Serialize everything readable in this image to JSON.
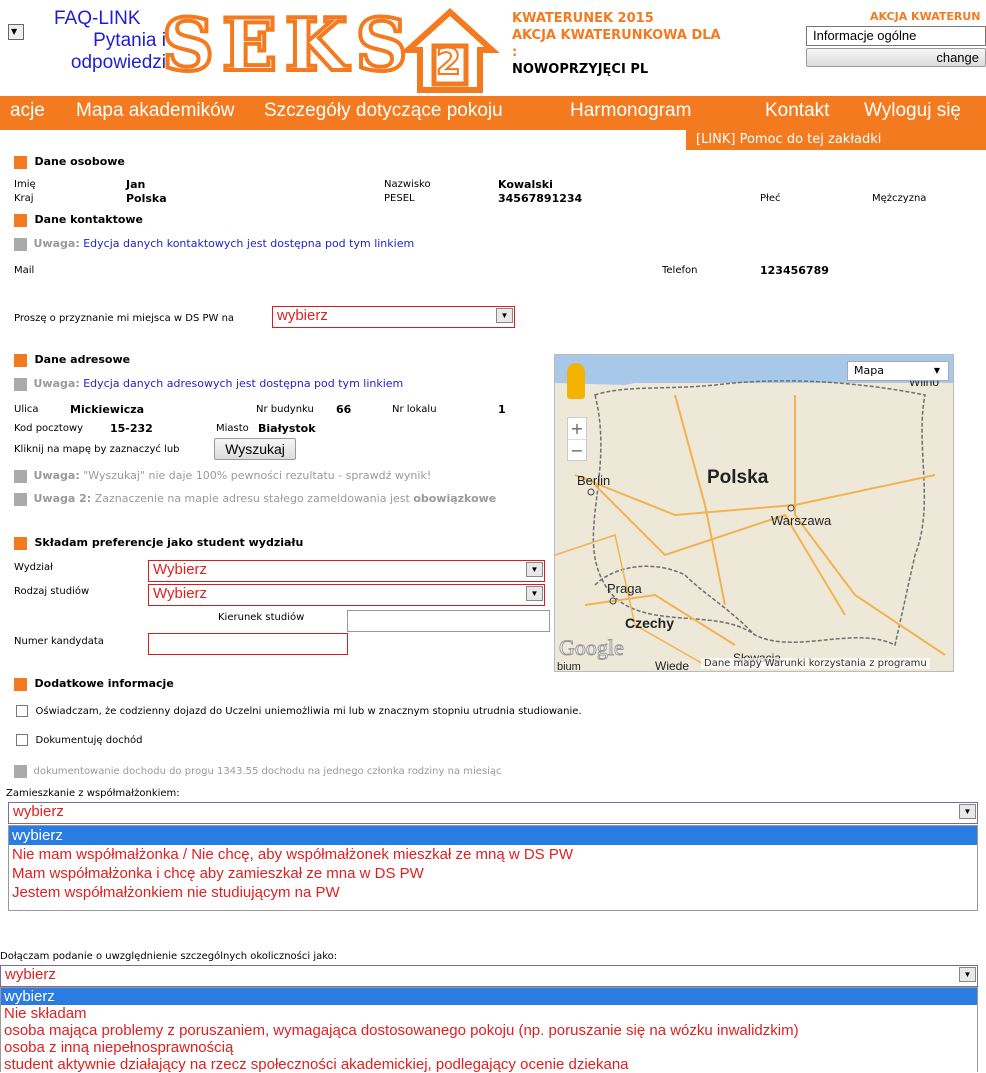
{
  "header": {
    "faq_line1": "FAQ-LINK",
    "faq_line2": "Pytania i",
    "faq_line3": "odpowiedzi",
    "logo_text": "SEKS",
    "logo_digit": "2",
    "title_line1": "KWATERUNEK 2015",
    "title_line2": "AKCJA KWATERUNKOWA DLA",
    "title_colon": ":",
    "title_line3": "NOWOPRZYJĘCI PL",
    "right_label": "AKCJA KWATERUN",
    "right_select_value": "Informacje ogólne",
    "change_button": "change"
  },
  "menu": {
    "items": [
      "acje",
      "Mapa akademików",
      "Szczegóły dotyczące pokoju",
      "Harmonogram",
      "Kontakt",
      "Wyloguj się"
    ],
    "help_link": "[LINK] Pomoc do tej zakładki"
  },
  "personal": {
    "title": "Dane osobowe",
    "first_name_label": "Imię",
    "first_name": "Jan",
    "last_name_label": "Nazwisko",
    "last_name": "Kowalski",
    "country_label": "Kraj",
    "country": "Polska",
    "pesel_label": "PESEL",
    "pesel": "34567891234",
    "sex_label": "Płeć",
    "sex": "Mężczyzna"
  },
  "contact": {
    "title": "Dane kontaktowe",
    "note_prefix": "Uwaga:",
    "note_link": "Edycja danych kontaktowych jest dostępna pod tym linkiem",
    "mail_label": "Mail",
    "phone_label": "Telefon",
    "phone": "123456789"
  },
  "request": {
    "label": "Proszę o przyznanie mi miejsca w DS PW na",
    "value": "wybierz"
  },
  "address": {
    "title": "Dane adresowe",
    "note_prefix": "Uwaga:",
    "note_link": "Edycja danych adresowych jest dostępna pod tym linkiem",
    "street_label": "Ulica",
    "street": "Mickiewicza",
    "building_label": "Nr budynku",
    "building": "66",
    "flat_label": "Nr lokalu",
    "flat": "1",
    "zip_label": "Kod pocztowy",
    "zip": "15-232",
    "city_label": "Miasto",
    "city": "Białystok",
    "map_hint": "Kliknij na mapę by zaznaczyć lub",
    "search_button": "Wyszukaj",
    "warn1_prefix": "Uwaga:",
    "warn1_text": "\"Wyszukaj\" nie daje 100% pewności rezultatu - sprawdź wynik!",
    "warn2_prefix": "Uwaga 2:",
    "warn2_text": "Zaznaczenie na mapie adresu stałego zameldowania jest",
    "warn2_bold": "obowiązkowe"
  },
  "map": {
    "type_label": "Mapa",
    "label_polska": "Polska",
    "label_berlin": "Berlin",
    "label_warszawa": "Warszawa",
    "label_praga": "Praga",
    "label_czechy": "Czechy",
    "label_wilno": "Wilno",
    "label_wieden": "Wiede",
    "label_slowacja": "Słowacja",
    "label_bium": "bium",
    "google": "Google",
    "attribution": "Dane mapy   Warunki korzystania z programu",
    "zoom_in": "+",
    "zoom_out": "−",
    "land_color": "#ede8d8",
    "road_color": "#f1b351",
    "border_color": "#6f6f6f"
  },
  "faculty": {
    "title": "Składam preferencje jako student wydziału",
    "faculty_label": "Wydział",
    "faculty_value": "Wybierz",
    "type_label": "Rodzaj studiów",
    "type_value": "Wybierz",
    "direction_label": "Kierunek studiów",
    "candidate_label": "Numer kandydata"
  },
  "extra": {
    "title": "Dodatkowe informacje",
    "commute_text": "Oświadczam, że codzienny dojazd do Uczelni uniemożliwia mi lub w znacznym stopniu utrudnia studiowanie.",
    "income_text": "Dokumentuję dochód",
    "income_note": "dokumentowanie dochodu do progu 1343.55 dochodu na jednego członka rodziny na miesiąc"
  },
  "spouse": {
    "label": "Zamieszkanie z współmałżonkiem:",
    "value": "wybierz",
    "options": [
      "wybierz",
      "Nie mam współmałżonka / Nie chcę, aby współmałżonek mieszkał ze mną w DS PW",
      "Mam współmałżonka i chcę aby zamieszkał ze mna w DS PW",
      "Jestem współmałżonkiem nie studiującym na PW"
    ]
  },
  "special": {
    "label": "Dołączam podanie o uwzględnienie szczególnych okoliczności jako:",
    "value": "wybierz",
    "options": [
      "wybierz",
      "Nie składam",
      "osoba mająca problemy z poruszaniem, wymagająca dostosowanego pokoju (np. poruszanie się na wózku inwalidzkim)",
      "osoba z inną niepełnosprawnością",
      "student aktywnie działający na rzecz społeczności akademickiej, podlegający ocenie dziekana"
    ]
  },
  "colors": {
    "accent": "#f47a20",
    "error": "#e02020",
    "link": "#1f1fd0",
    "highlight": "#2a7ce2"
  }
}
